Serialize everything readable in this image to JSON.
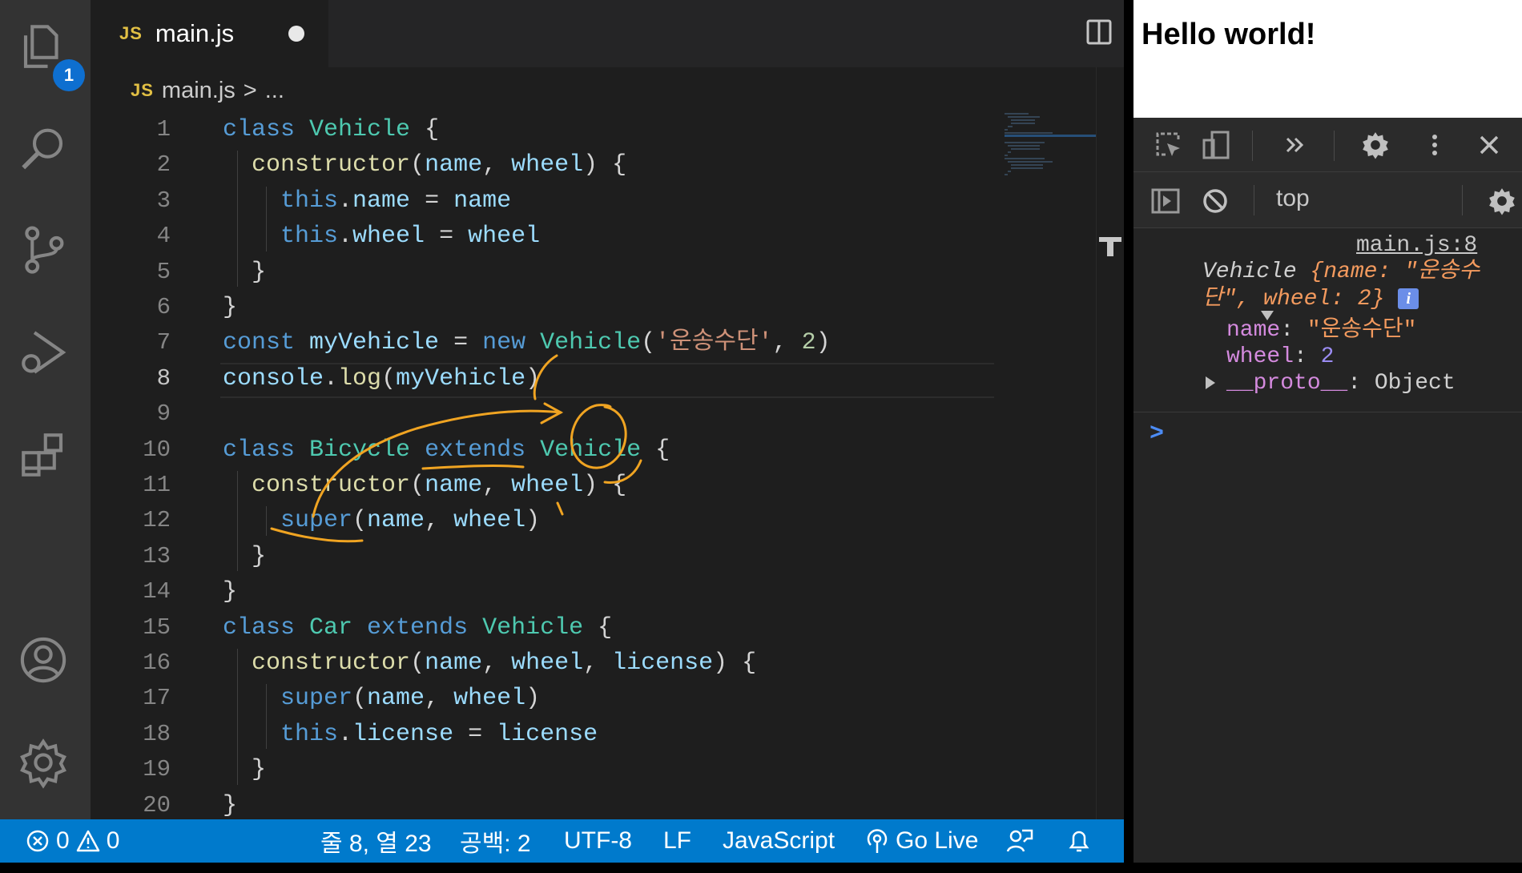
{
  "editor": {
    "tab": {
      "lang_icon": "JS",
      "filename": "main.js"
    },
    "breadcrumb": {
      "lang_icon": "JS",
      "file": "main.js",
      "separator": ">",
      "rest": "..."
    },
    "activity": {
      "explorer_badge": "1",
      "icons": [
        "files-icon",
        "search-icon",
        "source-control-icon",
        "run-debug-icon",
        "extensions-icon",
        "account-icon",
        "settings-gear-icon"
      ]
    },
    "lines": [
      {
        "n": "1",
        "tokens": [
          [
            "kw",
            "class "
          ],
          [
            "cls",
            "Vehicle"
          ],
          [
            "pl",
            " {"
          ]
        ]
      },
      {
        "n": "2",
        "tokens": [
          [
            "pl",
            "  "
          ],
          [
            "fn",
            "constructor"
          ],
          [
            "pl",
            "("
          ],
          [
            "var",
            "name"
          ],
          [
            "pl",
            ", "
          ],
          [
            "var",
            "wheel"
          ],
          [
            "pl",
            ") {"
          ]
        ]
      },
      {
        "n": "3",
        "tokens": [
          [
            "pl",
            "    "
          ],
          [
            "kw",
            "this"
          ],
          [
            "pl",
            "."
          ],
          [
            "var",
            "name"
          ],
          [
            "pl",
            " = "
          ],
          [
            "var",
            "name"
          ]
        ]
      },
      {
        "n": "4",
        "tokens": [
          [
            "pl",
            "    "
          ],
          [
            "kw",
            "this"
          ],
          [
            "pl",
            "."
          ],
          [
            "var",
            "wheel"
          ],
          [
            "pl",
            " = "
          ],
          [
            "var",
            "wheel"
          ]
        ]
      },
      {
        "n": "5",
        "tokens": [
          [
            "pl",
            "  }"
          ]
        ]
      },
      {
        "n": "6",
        "tokens": [
          [
            "pl",
            "}"
          ]
        ]
      },
      {
        "n": "7",
        "tokens": [
          [
            "kw",
            "const "
          ],
          [
            "var",
            "myVehicle"
          ],
          [
            "pl",
            " = "
          ],
          [
            "kw",
            "new "
          ],
          [
            "cls",
            "Vehicle"
          ],
          [
            "pl",
            "("
          ],
          [
            "str",
            "'운송수단'"
          ],
          [
            "pl",
            ", "
          ],
          [
            "num",
            "2"
          ],
          [
            "pl",
            ")"
          ]
        ]
      },
      {
        "n": "8",
        "tokens": [
          [
            "var",
            "console"
          ],
          [
            "pl",
            "."
          ],
          [
            "fn",
            "log"
          ],
          [
            "pl",
            "("
          ],
          [
            "var",
            "myVehicle"
          ],
          [
            "pl",
            ")"
          ]
        ]
      },
      {
        "n": "9",
        "tokens": []
      },
      {
        "n": "10",
        "tokens": [
          [
            "kw",
            "class "
          ],
          [
            "cls",
            "Bicycle "
          ],
          [
            "kw",
            "extends "
          ],
          [
            "cls",
            "Vehicle"
          ],
          [
            "pl",
            " {"
          ]
        ]
      },
      {
        "n": "11",
        "tokens": [
          [
            "pl",
            "  "
          ],
          [
            "fn",
            "constructor"
          ],
          [
            "pl",
            "("
          ],
          [
            "var",
            "name"
          ],
          [
            "pl",
            ", "
          ],
          [
            "var",
            "wheel"
          ],
          [
            "pl",
            ") {"
          ]
        ]
      },
      {
        "n": "12",
        "tokens": [
          [
            "pl",
            "    "
          ],
          [
            "kw",
            "super"
          ],
          [
            "pl",
            "("
          ],
          [
            "var",
            "name"
          ],
          [
            "pl",
            ", "
          ],
          [
            "var",
            "wheel"
          ],
          [
            "pl",
            ")"
          ]
        ]
      },
      {
        "n": "13",
        "tokens": [
          [
            "pl",
            "  }"
          ]
        ]
      },
      {
        "n": "14",
        "tokens": [
          [
            "pl",
            "}"
          ]
        ]
      },
      {
        "n": "15",
        "tokens": [
          [
            "kw",
            "class "
          ],
          [
            "cls",
            "Car "
          ],
          [
            "kw",
            "extends "
          ],
          [
            "cls",
            "Vehicle"
          ],
          [
            "pl",
            " {"
          ]
        ]
      },
      {
        "n": "16",
        "tokens": [
          [
            "pl",
            "  "
          ],
          [
            "fn",
            "constructor"
          ],
          [
            "pl",
            "("
          ],
          [
            "var",
            "name"
          ],
          [
            "pl",
            ", "
          ],
          [
            "var",
            "wheel"
          ],
          [
            "pl",
            ", "
          ],
          [
            "var",
            "license"
          ],
          [
            "pl",
            ") {"
          ]
        ]
      },
      {
        "n": "17",
        "tokens": [
          [
            "pl",
            "    "
          ],
          [
            "kw",
            "super"
          ],
          [
            "pl",
            "("
          ],
          [
            "var",
            "name"
          ],
          [
            "pl",
            ", "
          ],
          [
            "var",
            "wheel"
          ],
          [
            "pl",
            ")"
          ]
        ]
      },
      {
        "n": "18",
        "tokens": [
          [
            "pl",
            "    "
          ],
          [
            "kw",
            "this"
          ],
          [
            "pl",
            "."
          ],
          [
            "var",
            "license"
          ],
          [
            "pl",
            " = "
          ],
          [
            "var",
            "license"
          ]
        ]
      },
      {
        "n": "19",
        "tokens": [
          [
            "pl",
            "  }"
          ]
        ]
      },
      {
        "n": "20",
        "tokens": [
          [
            "pl",
            "}"
          ]
        ]
      }
    ],
    "current_line": "8"
  },
  "statusbar": {
    "errors": "0",
    "warnings": "0",
    "position": "줄 8, 열 23",
    "spaces": "공백: 2",
    "encoding": "UTF-8",
    "eol": "LF",
    "language": "JavaScript",
    "go_live": "Go Live"
  },
  "browser": {
    "page_heading": "Hello world!",
    "devtools": {
      "context": "top",
      "source_link": "main.js:8",
      "log": {
        "summary_class": "Vehicle",
        "summary_rest_1": " {name: \"운송수",
        "summary_rest_2": "단\", wheel: 2}",
        "prop_name_key": "name",
        "prop_name_val": "\"운송수단\"",
        "prop_wheel_key": "wheel",
        "prop_wheel_val": "2",
        "proto_key": "__proto__",
        "proto_val": "Object"
      },
      "info_badge": "i",
      "prompt": ">"
    }
  },
  "colors": {
    "statusbar": "#007acc",
    "annotation": "#f0a422",
    "keyword": "#569cd6",
    "class": "#4ec9b0",
    "function": "#dcdcaa"
  }
}
